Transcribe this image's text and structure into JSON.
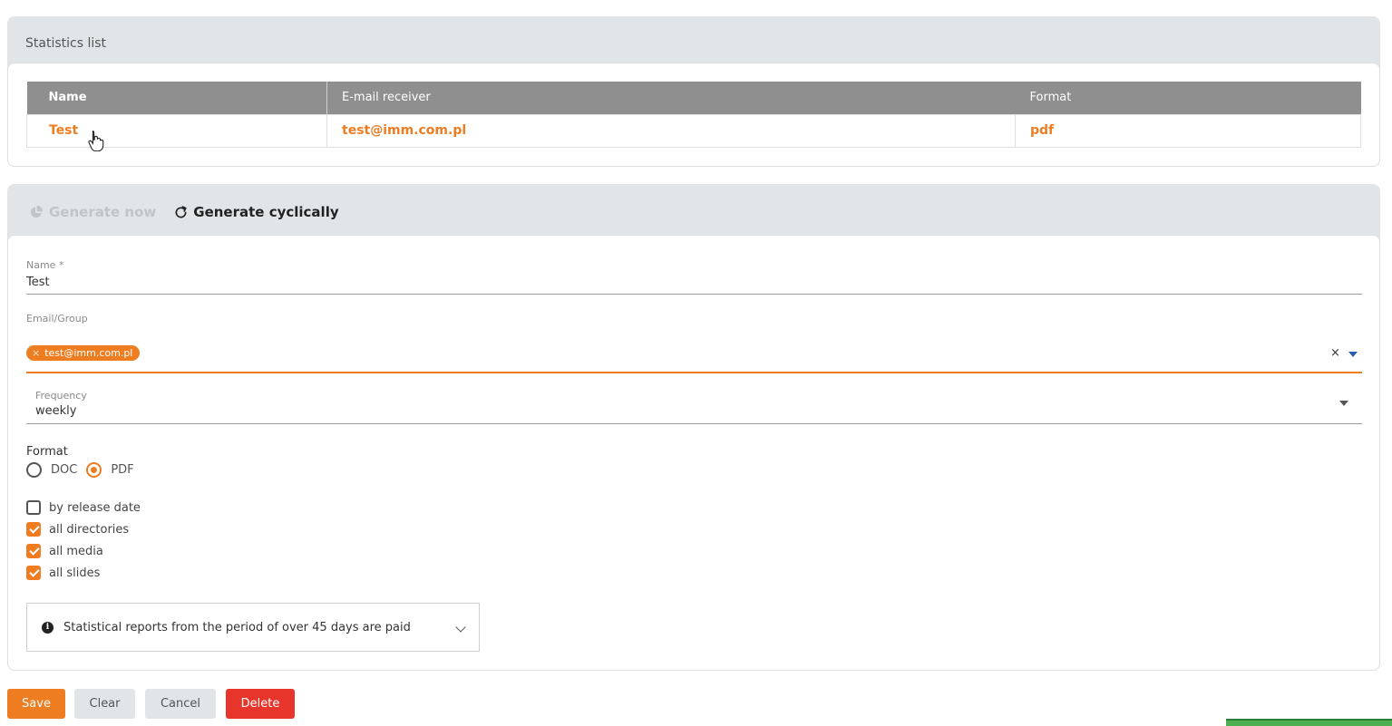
{
  "stats": {
    "title": "Statistics list",
    "columns": {
      "name": "Name",
      "email": "E-mail receiver",
      "format": "Format"
    },
    "rows": [
      {
        "name": "Test",
        "email": "test@imm.com.pl",
        "format": "pdf"
      }
    ]
  },
  "tabs": {
    "generate_now": "Generate now",
    "generate_cyclically": "Generate cyclically"
  },
  "form": {
    "name_label": "Name *",
    "name_value": "Test",
    "email_label": "Email/Group",
    "email_chip": "test@imm.com.pl",
    "chip_remove": "×",
    "clear_all": "×",
    "frequency_label": "Frequency",
    "frequency_value": "weekly",
    "format_label": "Format",
    "format_options": [
      "DOC",
      "PDF"
    ],
    "format_selected": "PDF",
    "checkboxes": [
      {
        "label": "by release date",
        "checked": false
      },
      {
        "label": "all directories",
        "checked": true
      },
      {
        "label": "all media",
        "checked": true
      },
      {
        "label": "all slides",
        "checked": true
      }
    ],
    "info_text": "Statistical reports from the period of over 45 days are paid"
  },
  "buttons": {
    "save": "Save",
    "clear": "Clear",
    "cancel": "Cancel",
    "delete": "Delete"
  },
  "colors": {
    "accent": "#ee7d22",
    "danger": "#e8352c",
    "header_bg": "#8f8f8f",
    "panel_bg": "#e2e5e8"
  }
}
